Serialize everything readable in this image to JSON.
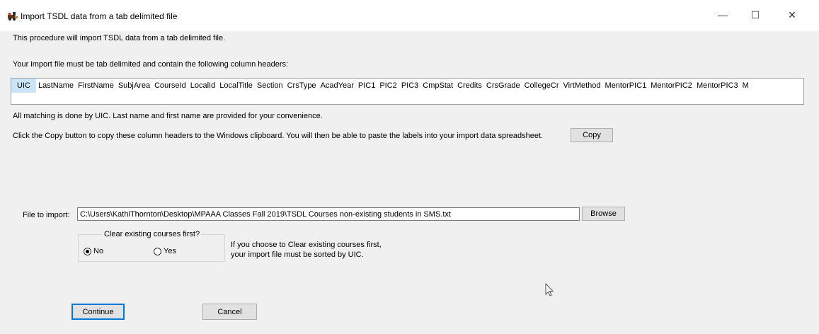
{
  "window": {
    "title": "Import TSDL data from a tab delimited file",
    "minimize_glyph": "—",
    "maximize_glyph": "☐",
    "close_glyph": "✕"
  },
  "intro": {
    "line1": "This procedure will import TSDL data from a tab delimited file.",
    "line2": "Your import file must be tab delimited and contain the following column headers:"
  },
  "columns": [
    "UIC",
    "LastName",
    "FirstName",
    "SubjArea",
    "CourseId",
    "LocalId",
    "LocalTitle",
    "Section",
    "CrsType",
    "AcadYear",
    "PIC1",
    "PIC2",
    "PIC3",
    "CmpStat",
    "Credits",
    "CrsGrade",
    "CollegeCr",
    "VirtMethod",
    "MentorPIC1",
    "MentorPIC2",
    "MentorPIC3",
    "M"
  ],
  "notes": {
    "matching": "All matching is done by UIC.  Last name and first name are provided for your convenience.",
    "copy": "Click the Copy button to copy these column headers to the Windows clipboard.  You will then be able to paste the labels into your import data spreadsheet."
  },
  "buttons": {
    "copy": "Copy",
    "browse": "Browse",
    "continue": "Continue",
    "cancel": "Cancel"
  },
  "file": {
    "label": "File to import:",
    "value": "C:\\Users\\KathiThornton\\Desktop\\MPAAA Classes Fall 2019\\TSDL Courses non-existing students in SMS.txt"
  },
  "clear_group": {
    "legend": "Clear existing courses first?",
    "no_label": "No",
    "yes_label": "Yes",
    "selected": "No",
    "note_line1": "If you choose to Clear existing courses first,",
    "note_line2": "your import file must be sorted by UIC."
  },
  "icons": {
    "app": "train-icon",
    "cursor": "mouse-pointer-icon"
  }
}
